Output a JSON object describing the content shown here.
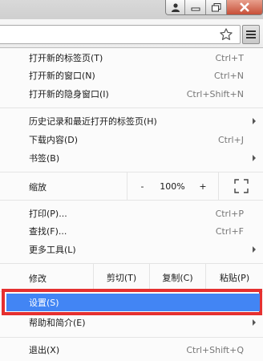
{
  "colors": {
    "highlight_fill": "#4285f4",
    "highlight_border": "#e53030",
    "shortcut_text": "#777777"
  },
  "window_controls": {
    "icons": [
      "user-icon",
      "minimize-icon",
      "restore-icon",
      "close-icon"
    ]
  },
  "toolbar": {
    "bookmark_icon": "star-icon",
    "menu_icon": "hamburger-menu-icon"
  },
  "menu": {
    "group1": [
      {
        "label": "打开新的标签页(T)",
        "shortcut": "Ctrl+T"
      },
      {
        "label": "打开新的窗口(N)",
        "shortcut": "Ctrl+N"
      },
      {
        "label": "打开新的隐身窗口(I)",
        "shortcut": "Ctrl+Shift+N"
      }
    ],
    "group2": [
      {
        "label": "历史记录和最近打开的标签页(H)",
        "shortcut": "",
        "submenu": true
      },
      {
        "label": "下载内容(D)",
        "shortcut": "Ctrl+J"
      },
      {
        "label": "书签(B)",
        "shortcut": "",
        "submenu": true
      }
    ],
    "zoom": {
      "label": "缩放",
      "minus": "-",
      "value": "100%",
      "plus": "+",
      "fullscreen_icon": "fullscreen-icon"
    },
    "group3": [
      {
        "label": "打印(P)...",
        "shortcut": "Ctrl+P"
      },
      {
        "label": "查找(F)...",
        "shortcut": "Ctrl+F"
      },
      {
        "label": "更多工具(L)",
        "shortcut": "",
        "submenu": true
      }
    ],
    "edit": {
      "label": "修改",
      "cut": "剪切(T)",
      "copy": "复制(C)",
      "paste": "粘贴(P)"
    },
    "settings": {
      "label": "设置(S)"
    },
    "help": {
      "label": "帮助和简介(E)",
      "submenu": true
    },
    "exit": {
      "label": "退出(X)",
      "shortcut": "Ctrl+Shift+Q"
    }
  }
}
